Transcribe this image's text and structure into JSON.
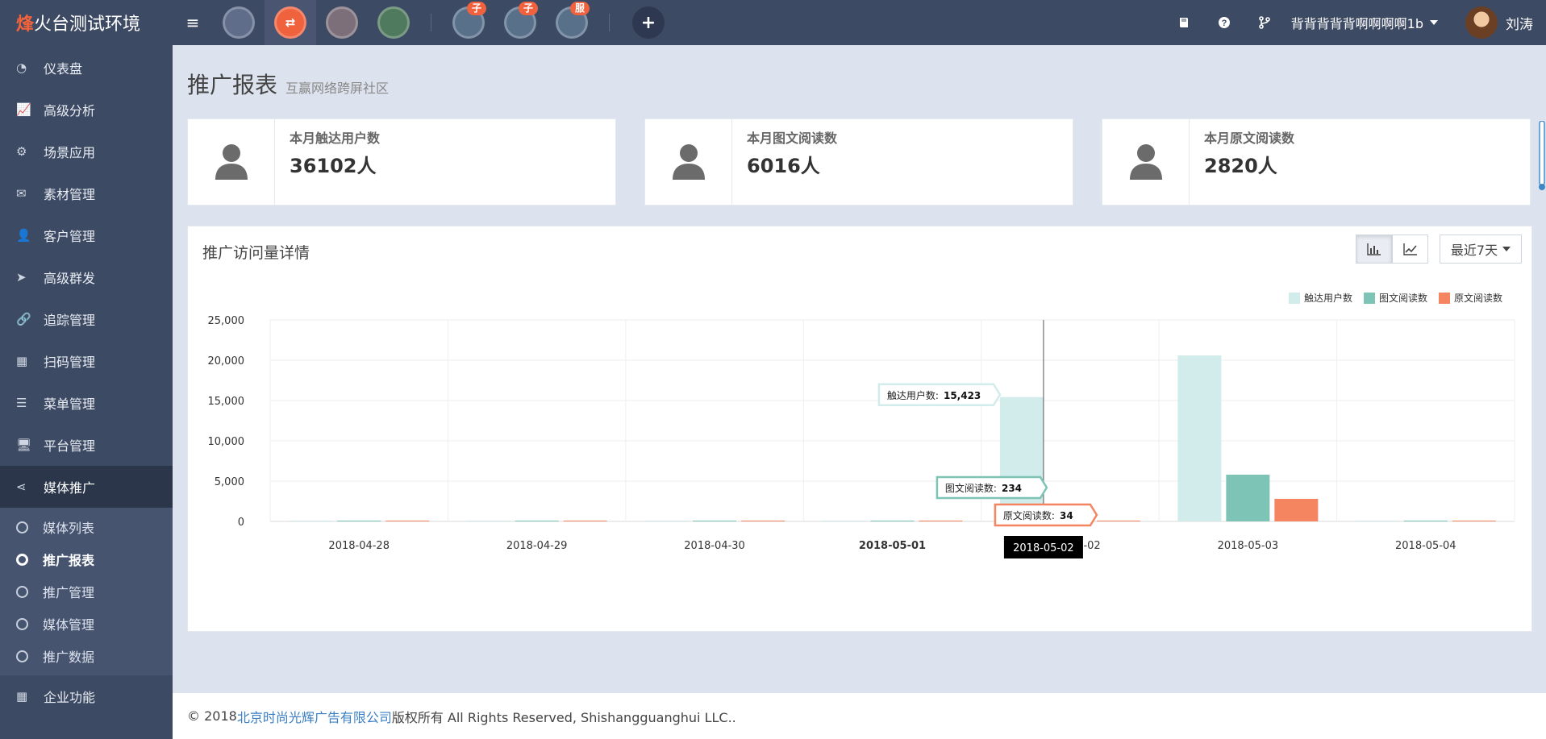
{
  "brand": {
    "first_char": "烽",
    "rest": "火台测试环境"
  },
  "topbar": {
    "apps": [
      {
        "name": "app-1",
        "color": "#5f6d8a",
        "glyph": "",
        "badge": ""
      },
      {
        "name": "app-2",
        "color": "#f0613d",
        "glyph": "⇄",
        "badge": "",
        "active": true
      },
      {
        "name": "app-3",
        "color": "#7c6f7a",
        "glyph": "",
        "badge": ""
      },
      {
        "name": "wechat",
        "color": "#4f7a5d",
        "glyph": "",
        "badge": ""
      },
      {
        "name": "app-5",
        "color": "#58708a",
        "glyph": "",
        "badge": "子"
      },
      {
        "name": "app-6",
        "color": "#58708a",
        "glyph": "",
        "badge": "子"
      },
      {
        "name": "app-7",
        "color": "#58708a",
        "glyph": "",
        "badge": "服"
      }
    ],
    "username": "背背背背背啊啊啊啊1b",
    "realname": "刘涛"
  },
  "sidebar": {
    "items": [
      {
        "label": "仪表盘",
        "icon": "dashboard-icon",
        "glyph": "◔"
      },
      {
        "label": "高级分析",
        "icon": "chart-line-icon",
        "glyph": "📈"
      },
      {
        "label": "场景应用",
        "icon": "gear-icon",
        "glyph": "⚙"
      },
      {
        "label": "素材管理",
        "icon": "envelope-icon",
        "glyph": "✉"
      },
      {
        "label": "客户管理",
        "icon": "user-icon",
        "glyph": "👤"
      },
      {
        "label": "高级群发",
        "icon": "paper-plane-icon",
        "glyph": "➤"
      },
      {
        "label": "追踪管理",
        "icon": "link-icon",
        "glyph": "🔗"
      },
      {
        "label": "扫码管理",
        "icon": "qrcode-icon",
        "glyph": "▦"
      },
      {
        "label": "菜单管理",
        "icon": "list-icon",
        "glyph": "☰"
      },
      {
        "label": "平台管理",
        "icon": "desktop-icon",
        "glyph": "🖥"
      },
      {
        "label": "媒体推广",
        "icon": "share-icon",
        "glyph": "⋖"
      }
    ],
    "subitems": [
      "媒体列表",
      "推广报表",
      "推广管理",
      "媒体管理",
      "推广数据"
    ],
    "bottom_item": {
      "label": "企业功能",
      "icon": "grid-icon"
    }
  },
  "page": {
    "title": "推广报表",
    "subtitle": "互赢网络跨屏社区"
  },
  "stats": [
    {
      "label": "本月触达用户数",
      "value": "36102人"
    },
    {
      "label": "本月图文阅读数",
      "value": "6016人"
    },
    {
      "label": "本月原文阅读数",
      "value": "2820人"
    }
  ],
  "chart_panel": {
    "title": "推广访问量详情",
    "range_label": "最近7天"
  },
  "chart_data": {
    "type": "bar",
    "categories": [
      "2018-04-28",
      "2018-04-29",
      "2018-04-30",
      "2018-05-01",
      "2018-05-02",
      "2018-05-03",
      "2018-05-04"
    ],
    "series": [
      {
        "name": "触达用户数",
        "color": "#d2ecec",
        "values": [
          0,
          0,
          0,
          0,
          15423,
          20600,
          0
        ]
      },
      {
        "name": "图文阅读数",
        "color": "#7ec4b6",
        "values": [
          0,
          0,
          0,
          0,
          234,
          5800,
          0
        ]
      },
      {
        "name": "原文阅读数",
        "color": "#f58460",
        "values": [
          0,
          0,
          0,
          0,
          34,
          2800,
          0
        ]
      }
    ],
    "ylim": [
      0,
      25000
    ],
    "yticks": [
      "25,000",
      "20,000",
      "15,000",
      "10,000",
      "5,000",
      "0"
    ],
    "ytick_values": [
      25000,
      20000,
      15000,
      10000,
      5000,
      0
    ],
    "legend_position": "top-right",
    "grid": true,
    "tooltip": {
      "category": "2018-05-02",
      "items": [
        {
          "label": "触达用户数",
          "value": "15,423"
        },
        {
          "label": "图文阅读数",
          "value": "234"
        },
        {
          "label": "原文阅读数",
          "value": "34"
        }
      ]
    }
  },
  "footer": {
    "prefix": "© 2018 ",
    "company": "北京时尚光辉广告有限公司",
    "suffix": " 版权所有 All Rights Reserved, Shishangguanghui LLC.."
  }
}
